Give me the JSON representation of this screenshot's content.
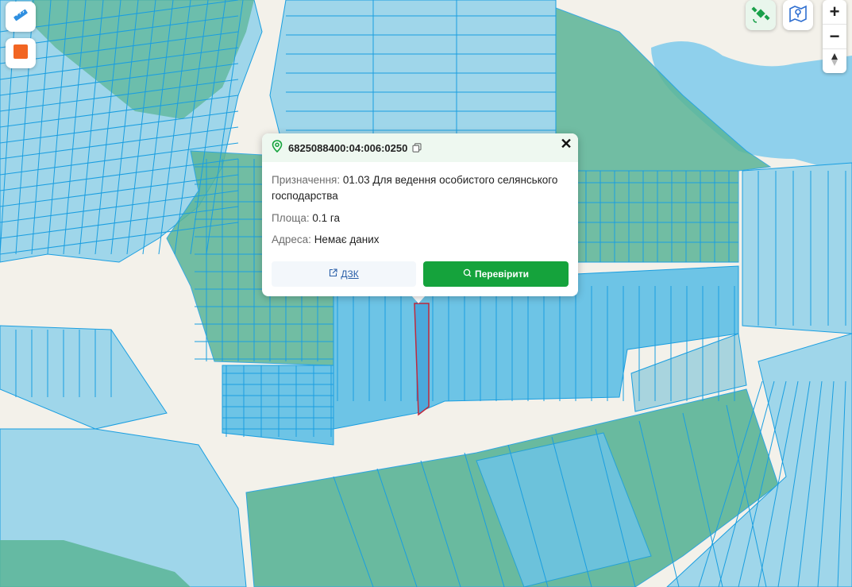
{
  "map": {
    "colors": {
      "background": "#f3f1ea",
      "parcel_fill": "#9fd6ea",
      "parcel_fill_dark": "#6dc4e6",
      "parcel_stroke": "#1a9ee0",
      "green_area": "#5bb597",
      "water": "#8fd0ec",
      "selected_stroke": "#c0283c"
    }
  },
  "controls": {
    "ruler_icon": "ruler-icon",
    "draw_polygon_icon": "square-icon",
    "satellite_icon": "satellite-icon",
    "map_layers_icon": "map-icon",
    "zoom_in": "+",
    "zoom_out": "−",
    "compass_icon": "compass-icon"
  },
  "popup": {
    "cadastral_number": "6825088400:04:006:0250",
    "purpose_label": "Призначення:",
    "purpose_value": "01.03 Для ведення особистого селянського господарства",
    "area_label": "Площа:",
    "area_value": "0.1 га",
    "address_label": "Адреса:",
    "address_value": "Немає даних",
    "dzk_button": "ДЗК",
    "check_button": "Перевірити",
    "close_symbol": "✕"
  }
}
